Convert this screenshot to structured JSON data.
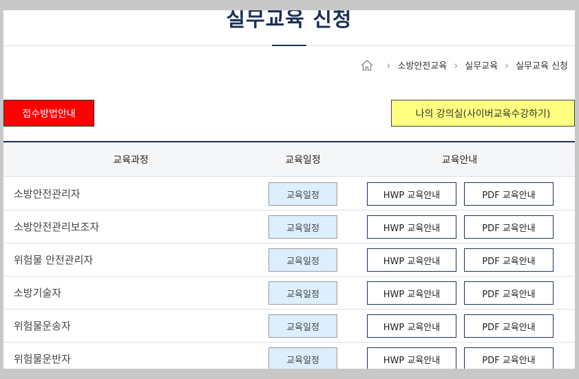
{
  "page": {
    "title": "실무교육 신청"
  },
  "breadcrumb": {
    "items": [
      "소방안전교육",
      "실무교육",
      "실무교육 신청"
    ]
  },
  "buttons": {
    "guide": "접수방법안내",
    "my_classroom": "나의 강의실(사이버교육수강하기)"
  },
  "table": {
    "headers": [
      "교육과정",
      "교육일정",
      "교육안내"
    ],
    "rows": [
      {
        "course": "소방안전관리자",
        "schedule": "교육일정",
        "hwp": "HWP 교육안내",
        "pdf": "PDF 교육안내"
      },
      {
        "course": "소방안전관리보조자",
        "schedule": "교육일정",
        "hwp": "HWP 교육안내",
        "pdf": "PDF 교육안내"
      },
      {
        "course": "위험물 안전관리자",
        "schedule": "교육일정",
        "hwp": "HWP 교육안내",
        "pdf": "PDF 교육안내"
      },
      {
        "course": "소방기술자",
        "schedule": "교육일정",
        "hwp": "HWP 교육안내",
        "pdf": "PDF 교육안내"
      },
      {
        "course": "위험물운송자",
        "schedule": "교육일정",
        "hwp": "HWP 교육안내",
        "pdf": "PDF 교육안내"
      },
      {
        "course": "위험물운반자",
        "schedule": "교육일정",
        "hwp": "HWP 교육안내",
        "pdf": "PDF 교육안내"
      }
    ]
  },
  "colors": {
    "brand": "#1b2f55",
    "guide_button": "#ff0000",
    "classroom_button": "#ffff80",
    "schedule_button": "#ddeeff"
  }
}
